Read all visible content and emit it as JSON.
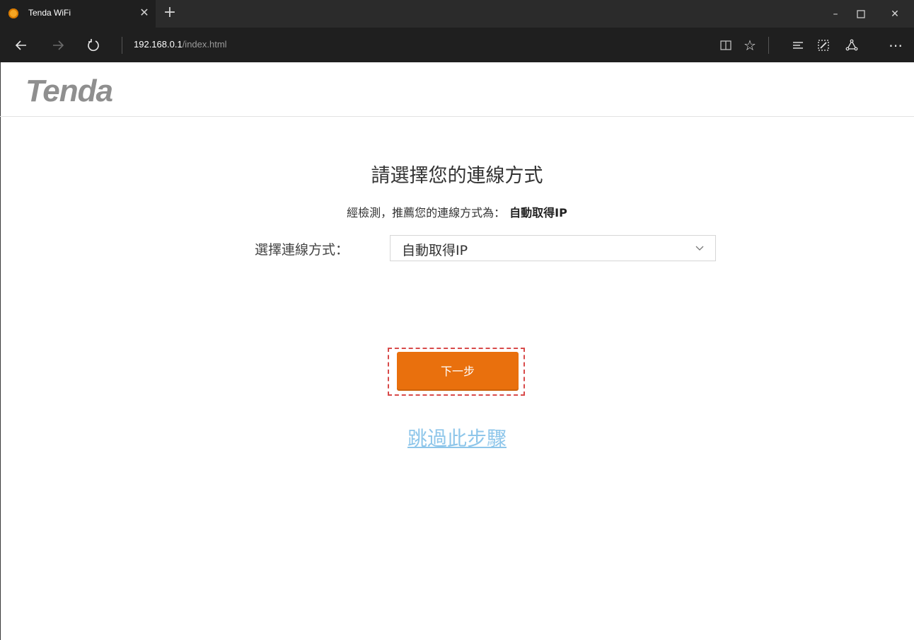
{
  "browser": {
    "tab_title": "Tenda WiFi",
    "url_host": "192.168.0.1",
    "url_path": "/index.html"
  },
  "brand": {
    "logo_text": "Tenda",
    "logo_color": "#8f8f8f"
  },
  "page": {
    "title": "請選擇您的連線方式",
    "detect_text": "經檢測，推薦您的連線方式為：",
    "detect_value": "自動取得IP",
    "select_label": "選擇連線方式：",
    "select_value": "自動取得IP",
    "next_button_label": "下一步",
    "skip_link_label": "跳過此步驟"
  },
  "colors": {
    "accent": "#e9700d",
    "link": "#8ec6ea",
    "highlight": "#d84a4a"
  },
  "icons": {
    "back": "arrow-left-icon",
    "forward": "arrow-right-icon",
    "refresh": "refresh-icon",
    "reading_view": "book-icon",
    "favorite": "star-icon",
    "hub": "hub-icon",
    "notes": "pen-note-icon",
    "share": "share-icon",
    "more": "more-icon"
  }
}
